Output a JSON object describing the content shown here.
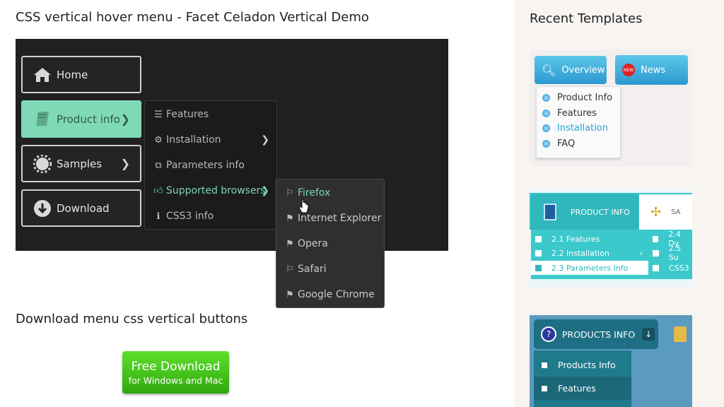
{
  "header": {
    "title": "CSS vertical hover menu - Facet Celadon Vertical Demo"
  },
  "demo_menu": {
    "items": [
      {
        "label": "Home",
        "icon": "home-icon"
      },
      {
        "label": "Product info",
        "icon": "book-icon",
        "has_submenu": true
      },
      {
        "label": "Samples",
        "icon": "gear-icon",
        "has_submenu": true
      },
      {
        "label": "Download",
        "icon": "download-icon"
      }
    ],
    "product_submenu": [
      {
        "label": "Features",
        "icon": "list-icon"
      },
      {
        "label": "Installation",
        "icon": "cogs-icon",
        "has_submenu": true
      },
      {
        "label": "Parameters info",
        "icon": "copy-icon"
      },
      {
        "label": "Supported browsers",
        "icon": "thumbs-up-icon",
        "has_submenu": true
      },
      {
        "label": "CSS3 info",
        "icon": "info-icon"
      }
    ],
    "browsers_submenu": [
      {
        "label": "Firefox",
        "icon": "flag-icon"
      },
      {
        "label": "Internet Explorer",
        "icon": "flag-checkered-icon"
      },
      {
        "label": "Opera",
        "icon": "flag-icon"
      },
      {
        "label": "Safari",
        "icon": "flag-icon"
      },
      {
        "label": "Google Chrome",
        "icon": "flag-checkered-icon"
      }
    ],
    "accent_color": "#7fd9b6"
  },
  "download": {
    "title": "Download menu css vertical buttons",
    "button_line1": "Free Download",
    "button_line2": "for Windows and Mac",
    "button_color": "#3cc21a"
  },
  "sidebar": {
    "title": "Recent Templates",
    "thumb1": {
      "tabs": [
        "Overview",
        "News"
      ],
      "items": [
        "Product Info",
        "Features",
        "Installation",
        "FAQ"
      ],
      "active_item": "Installation"
    },
    "thumb2": {
      "tab": "PRODUCT INFO",
      "tab2": "SA",
      "left_items": [
        "2.1 Features",
        "2.2 Installation",
        "2.3 Parameters Info"
      ],
      "right_items": [
        "2.4 Dy",
        "2.5 Su",
        "CSS3"
      ]
    },
    "thumb3": {
      "head": "PRODUCTS INFO",
      "items": [
        "Products Info",
        "Features"
      ]
    }
  }
}
